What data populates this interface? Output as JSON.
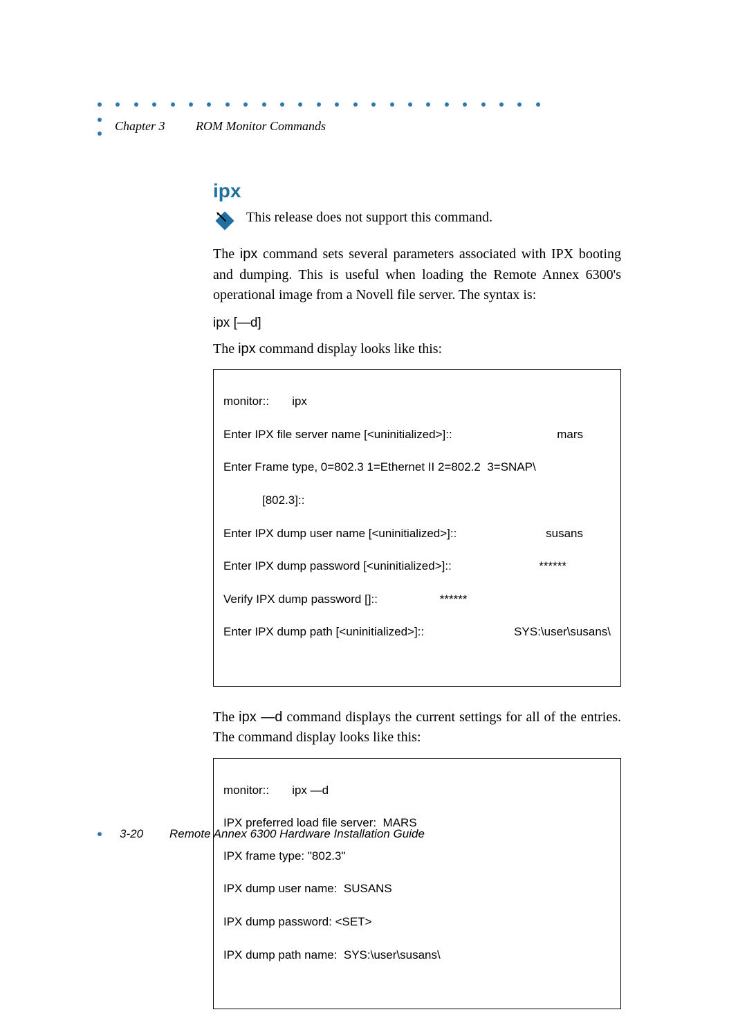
{
  "header": {
    "chapter": "Chapter 3",
    "title": "ROM Monitor Commands"
  },
  "section": {
    "heading": "ipx",
    "note_text": "This release does not support this command.",
    "para1_a": "The ",
    "para1_cmd": "ipx",
    "para1_b": " command sets several parameters associated with IPX booting and dumping. This is useful when loading the Remote Annex 6300's operational image from a Novell file server. The syntax is:",
    "syntax": "ipx  [—d]",
    "para2_a": "The ",
    "para2_cmd": "ipx",
    "para2_b": " command display looks like this:",
    "code1": {
      "l1a": "monitor::",
      "l1b": "ipx",
      "l2a": "Enter IPX file server name [<uninitialized>]::",
      "l2b": "mars",
      "l3": "Enter Frame type, 0=802.3 1=Ethernet II 2=802.2  3=SNAP\\",
      "l4": "[802.3]::",
      "l5a": "Enter IPX dump user name [<uninitialized>]::",
      "l5b": "susans",
      "l6a": "Enter IPX dump password [<uninitialized>]::",
      "l6b": "******",
      "l7a": "Verify IPX dump password []::",
      "l7b": "******",
      "l8a": "Enter IPX dump path [<uninitialized>]::",
      "l8b": "SYS:\\user\\susans\\"
    },
    "para3_a": "The ",
    "para3_cmd": "ipx —d",
    "para3_b": " command displays the current settings for all of the entries. The command display looks like this:",
    "code2": {
      "l1a": "monitor::",
      "l1b": "ipx —d",
      "l2": "IPX preferred load file server:  MARS",
      "l3": "IPX frame type: \"802.3\"",
      "l4": "IPX dump user name:  SUSANS",
      "l5": "IPX dump password: <SET>",
      "l6": "IPX dump path name:  SYS:\\user\\susans\\"
    }
  },
  "footer": {
    "page": "3-20",
    "guide": "Remote Annex 6300 Hardware Installation Guide"
  }
}
